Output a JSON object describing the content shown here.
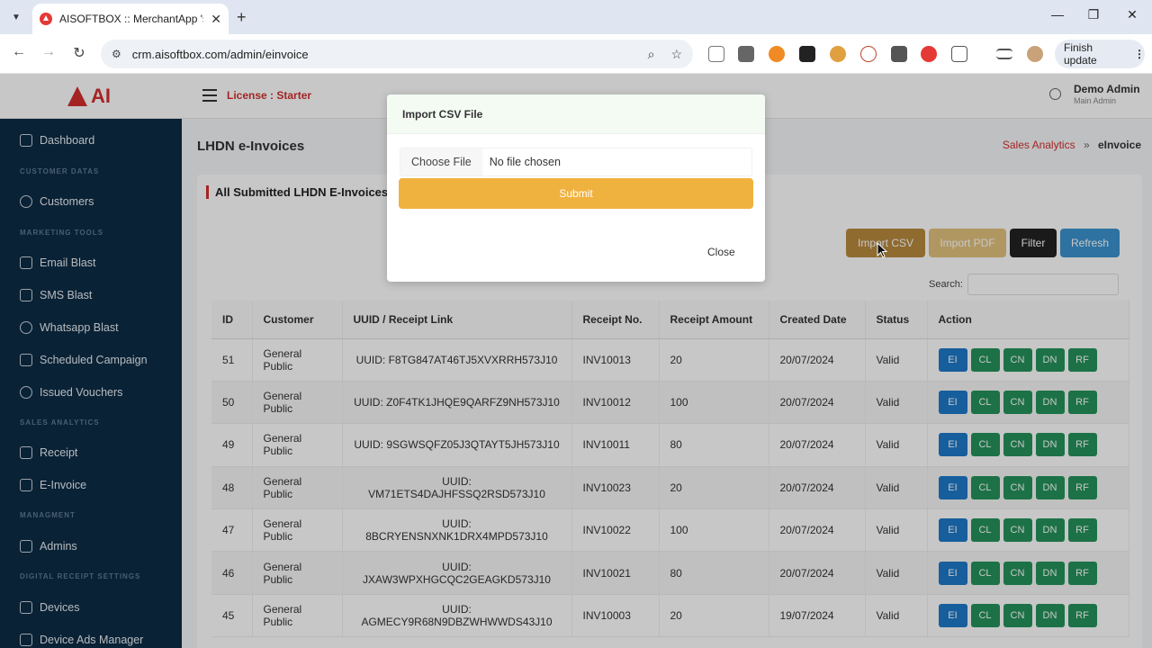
{
  "browser": {
    "tab_title": "AISOFTBOX :: MerchantApp 's C",
    "tab_close": "✕",
    "new_tab": "+",
    "url": "crm.aisoftbox.com/admin/einvoice",
    "finish_update": "Finish update",
    "window_controls": {
      "minimize": "—",
      "restore": "❐",
      "close": "✕"
    }
  },
  "header": {
    "logo_text": "AI",
    "license": "License : Starter",
    "user_name": "Demo Admin",
    "user_role": "Main Admin"
  },
  "sidebar": {
    "items": [
      {
        "label": "Dashboard",
        "icon": "home-icon"
      },
      {
        "section": "CUSTOMER DATAS"
      },
      {
        "label": "Customers",
        "icon": "users-icon"
      },
      {
        "section": "MARKETING TOOLS"
      },
      {
        "label": "Email Blast",
        "icon": "mail-icon"
      },
      {
        "label": "SMS Blast",
        "icon": "phone-icon"
      },
      {
        "label": "Whatsapp Blast",
        "icon": "whatsapp-icon"
      },
      {
        "label": "Scheduled Campaign",
        "icon": "calendar-icon"
      },
      {
        "label": "Issued Vouchers",
        "icon": "users-icon"
      },
      {
        "section": "SALES ANALYTICS"
      },
      {
        "label": "Receipt",
        "icon": "receipt-icon"
      },
      {
        "label": "E-Invoice",
        "icon": "invoice-icon"
      },
      {
        "section": "MANAGMENT"
      },
      {
        "label": "Admins",
        "icon": "admin-icon"
      },
      {
        "section": "DIGITAL RECEIPT SETTINGS"
      },
      {
        "label": "Devices",
        "icon": "device-icon"
      },
      {
        "label": "Device Ads Manager",
        "icon": "ads-icon"
      }
    ]
  },
  "main": {
    "page_title": "LHDN e-Invoices",
    "breadcrumb": {
      "parent": "Sales Analytics",
      "separator": "»",
      "current": "eInvoice"
    },
    "card_title": "All Submitted LHDN E-Invoices",
    "buttons": {
      "import_csv": "Import CSV",
      "import_pdf": "Import PDF",
      "filter": "Filter",
      "refresh": "Refresh"
    },
    "search_label": "Search:",
    "table": {
      "headers": [
        "ID",
        "Customer",
        "UUID / Receipt Link",
        "Receipt No.",
        "Receipt Amount",
        "Created Date",
        "Status",
        "Action"
      ],
      "rows": [
        [
          "51",
          "General Public",
          "UUID: F8TG847AT46TJ5XVXRRH573J10",
          "INV10013",
          "20",
          "20/07/2024",
          "Valid"
        ],
        [
          "50",
          "General Public",
          "UUID: Z0F4TK1JHQE9QARFZ9NH573J10",
          "INV10012",
          "100",
          "20/07/2024",
          "Valid"
        ],
        [
          "49",
          "General Public",
          "UUID: 9SGWSQFZ05J3QTAYT5JH573J10",
          "INV10011",
          "80",
          "20/07/2024",
          "Valid"
        ],
        [
          "48",
          "General Public",
          "UUID: VM71ETS4DAJHFSSQ2RSD573J10",
          "INV10023",
          "20",
          "20/07/2024",
          "Valid"
        ],
        [
          "47",
          "General Public",
          "UUID: 8BCRYENSNXNK1DRX4MPD573J10",
          "INV10022",
          "100",
          "20/07/2024",
          "Valid"
        ],
        [
          "46",
          "General Public",
          "UUID: JXAW3WPXHGCQC2GEAGKD573J10",
          "INV10021",
          "80",
          "20/07/2024",
          "Valid"
        ],
        [
          "45",
          "General Public",
          "UUID: AGMECY9R68N9DBZWHWWDS43J10",
          "INV10003",
          "20",
          "19/07/2024",
          "Valid"
        ]
      ],
      "actions": [
        "EI",
        "CL",
        "CN",
        "DN",
        "RF"
      ]
    }
  },
  "modal": {
    "title": "Import CSV File",
    "choose_file": "Choose File",
    "file_status": "No file chosen",
    "submit": "Submit",
    "close": "Close"
  },
  "colors": {
    "brand_red": "#d32f2f",
    "sidebar_bg": "#0e2c45",
    "submit": "#f0b23e",
    "ei_button": "#1d79c8",
    "action_green": "#24935a"
  }
}
